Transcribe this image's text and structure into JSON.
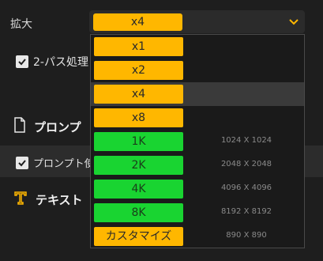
{
  "settings": {
    "scale_label": "拡大",
    "scale_selected": "x4",
    "two_pass_label": "2-パス処理",
    "prompt_section": "プロンプ",
    "prompt_checkbox_label": "プロンプト使",
    "text_section": "テキスト"
  },
  "dropdown": {
    "options": [
      {
        "label": "x1",
        "size": ""
      },
      {
        "label": "x2",
        "size": ""
      },
      {
        "label": "x4",
        "size": ""
      },
      {
        "label": "x8",
        "size": ""
      },
      {
        "label": "1K",
        "size": "1024 X 1024"
      },
      {
        "label": "2K",
        "size": "2048 X 2048"
      },
      {
        "label": "4K",
        "size": "4096 X 4096"
      },
      {
        "label": "8K",
        "size": "8192 X 8192"
      },
      {
        "label": "カスタマイズ",
        "size": "890 X 890"
      }
    ]
  },
  "colors": {
    "accent_yellow": "#ffb700",
    "accent_green": "#19d431"
  },
  "icons": {
    "chevron": "chevron-down-icon",
    "document": "document-icon",
    "text": "text-icon",
    "check": "check-icon"
  }
}
